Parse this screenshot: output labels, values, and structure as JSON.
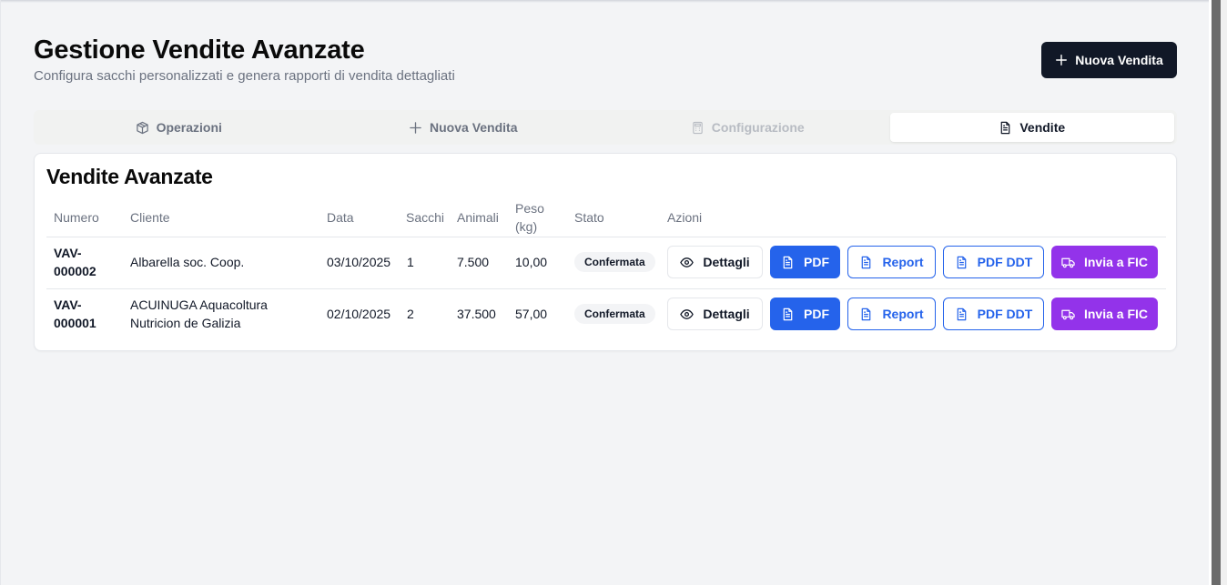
{
  "header": {
    "title": "Gestione Vendite Avanzate",
    "subtitle": "Configura sacchi personalizzati e genera rapporti di vendita dettagliati",
    "new_sale_button": "Nuova Vendita"
  },
  "tabs": [
    {
      "label": "Operazioni",
      "icon": "package-icon",
      "state": "normal"
    },
    {
      "label": "Nuova Vendita",
      "icon": "plus-icon",
      "state": "normal"
    },
    {
      "label": "Configurazione",
      "icon": "calculator-icon",
      "state": "disabled"
    },
    {
      "label": "Vendite",
      "icon": "document-icon",
      "state": "active"
    }
  ],
  "card": {
    "title": "Vendite Avanzate",
    "columns": {
      "numero": "Numero",
      "cliente": "Cliente",
      "data": "Data",
      "sacchi": "Sacchi",
      "animali": "Animali",
      "peso_line1": "Peso",
      "peso_line2": "(kg)",
      "stato": "Stato",
      "azioni": "Azioni"
    },
    "rows": [
      {
        "numero_line1": "VAV-",
        "numero_line2": "000002",
        "cliente_line1": "Albarella soc. Coop.",
        "cliente_line2": "",
        "data": "03/10/2025",
        "sacchi": "1",
        "animali": "7.500",
        "peso": "10,00",
        "stato": "Confermata"
      },
      {
        "numero_line1": "VAV-",
        "numero_line2": "000001",
        "cliente_line1": "ACUINUGA Aquacoltura",
        "cliente_line2": "Nutricion de Galizia",
        "data": "02/10/2025",
        "sacchi": "2",
        "animali": "37.500",
        "peso": "57,00",
        "stato": "Confermata"
      }
    ],
    "actions": {
      "details": "Dettagli",
      "pdf": "PDF",
      "report": "Report",
      "pdf_ddt": "PDF DDT",
      "send_fic": "Invia a FIC"
    }
  },
  "colors": {
    "primary_dark": "#111827",
    "blue": "#2563eb",
    "purple": "#9333ea",
    "muted_text": "#6b7280"
  }
}
